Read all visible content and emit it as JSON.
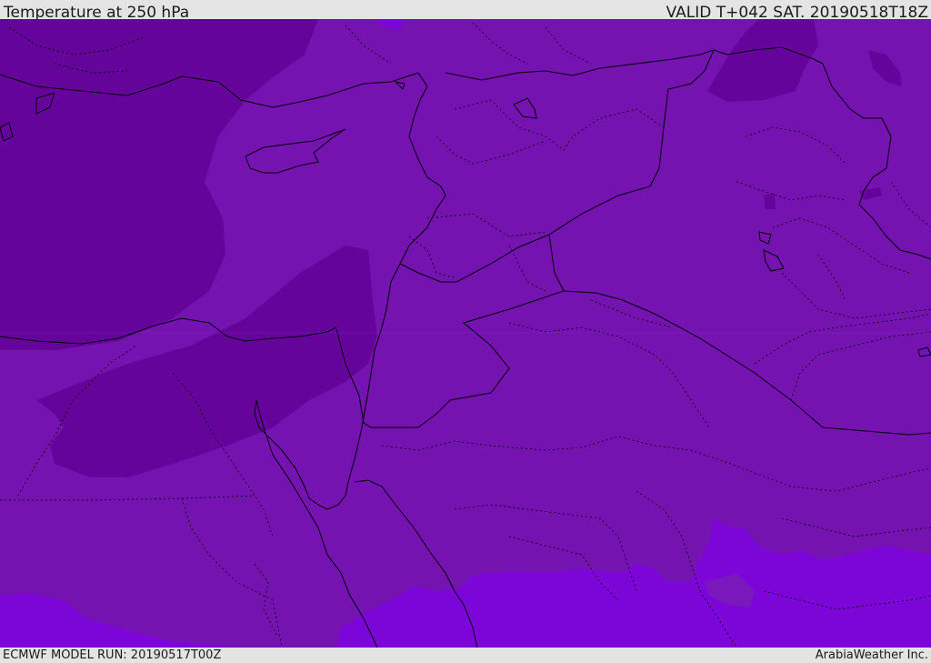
{
  "header": {
    "title": "Temperature at 250 hPa",
    "valid_time": "VALID T+042 SAT. 20190518T18Z"
  },
  "footer": {
    "model_run": "ECMWF MODEL RUN: 20190517T00Z",
    "credit": "ArabiaWeather Inc."
  },
  "map": {
    "colors": {
      "background_band": "#7413b0",
      "cold_band": "#65049b",
      "warm_band": "#7c05d8",
      "lake": "#7a18bd",
      "border_line": "#000000"
    }
  }
}
